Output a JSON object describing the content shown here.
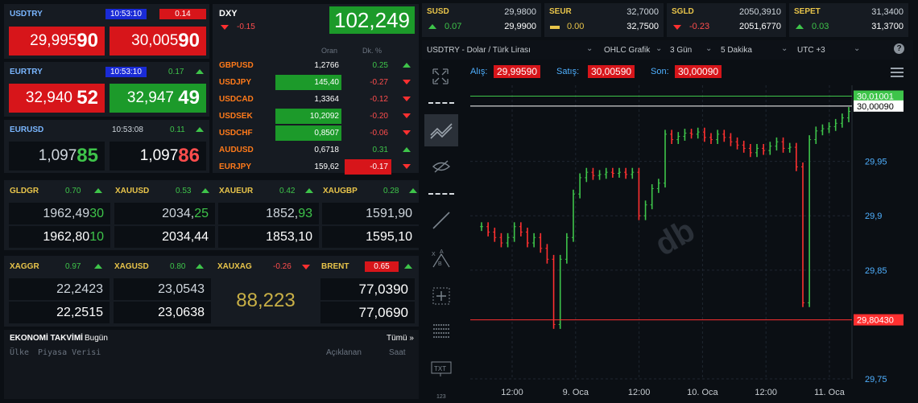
{
  "usdtry": {
    "sym": "USDTRY",
    "time": "10:53:10",
    "chg": "0.14",
    "bid_a": "29,995",
    "bid_b": "90",
    "ask_a": "30,005",
    "ask_b": "90"
  },
  "eurtry": {
    "sym": "EURTRY",
    "time": "10:53:10",
    "chg": "0.17",
    "bid_a": "32,940",
    "bid_b": "52",
    "ask_a": "32,947",
    "ask_b": "49"
  },
  "eurusd": {
    "sym": "EURUSD",
    "time": "10:53:08",
    "chg": "0.11",
    "bid_a": "1,097",
    "bid_b": "85",
    "ask_a": "1,097",
    "ask_b": "86"
  },
  "dxy": {
    "sym": "DXY",
    "chg": "-0.15",
    "value": "102,249"
  },
  "fx_table": {
    "h_rate": "Oran",
    "h_chg": "Dk. %",
    "rows": [
      {
        "sym": "GBPUSD",
        "rate": "1,2766",
        "chg": "0.25",
        "dir": "up",
        "hl": ""
      },
      {
        "sym": "USDJPY",
        "rate": "145,40",
        "chg": "-0.27",
        "dir": "down",
        "hl": "rate"
      },
      {
        "sym": "USDCAD",
        "rate": "1,3364",
        "chg": "-0.12",
        "dir": "down",
        "hl": ""
      },
      {
        "sym": "USDSEK",
        "rate": "10,2092",
        "chg": "-0.20",
        "dir": "down",
        "hl": "rate"
      },
      {
        "sym": "USDCHF",
        "rate": "0,8507",
        "chg": "-0.06",
        "dir": "down",
        "hl": "rate"
      },
      {
        "sym": "AUDUSD",
        "rate": "0,6718",
        "chg": "0.31",
        "dir": "up",
        "hl": ""
      },
      {
        "sym": "EURJPY",
        "rate": "159,62",
        "chg": "-0.17",
        "dir": "down",
        "hl": "chg"
      }
    ]
  },
  "metals": [
    {
      "sym": "GLDGR",
      "chg": "0.70",
      "bid_a": "1962,49",
      "bid_b": "30",
      "ask_a": "1962,80",
      "ask_b": "10",
      "ask_bg": "dark"
    },
    {
      "sym": "XAUUSD",
      "chg": "0.53",
      "bid_a": "2034,",
      "bid_b": "25",
      "ask_a": "2034,44",
      "ask_b": "",
      "ask_bg": "green"
    },
    {
      "sym": "XAUEUR",
      "chg": "0.42",
      "bid_a": "1852,",
      "bid_b": "93",
      "ask_a": "1853,10",
      "ask_b": "",
      "ask_bg": "green"
    },
    {
      "sym": "XAUGBP",
      "chg": "0.28",
      "bid_a": "1591,90",
      "bid_b": "",
      "ask_a": "1595,10",
      "ask_b": "",
      "ask_bg": "dark"
    }
  ],
  "row3": {
    "xaggr": {
      "sym": "XAGGR",
      "chg": "0.97",
      "bid": "22,2423",
      "ask": "22,2515"
    },
    "xagusd": {
      "sym": "XAGUSD",
      "chg": "0.80",
      "bid": "23,0543",
      "ask": "23,0638"
    },
    "xauxag": {
      "sym": "XAUXAG",
      "chg": "-0.26",
      "value": "88,223"
    },
    "brent": {
      "sym": "BRENT",
      "chg": "0.65",
      "bid": "77,0390",
      "ask": "77,0690"
    }
  },
  "calendar": {
    "title": "EKONOMİ TAKVİMİ",
    "subtitle": "Bugün",
    "all": "Tümü »",
    "h_country": "Ülke",
    "h_market": "Piyasa Verisi",
    "h_desc": "Açıklanan",
    "h_time": "Saat"
  },
  "top": [
    {
      "sym": "SUSD",
      "chg": "0.07",
      "v1": "29,9800",
      "v2": "29,9900",
      "dir": "up"
    },
    {
      "sym": "SEUR",
      "chg": "0.00",
      "v1": "32,7000",
      "v2": "32,7500",
      "dir": "flat"
    },
    {
      "sym": "SGLD",
      "chg": "-0.23",
      "v1": "2050,3910",
      "v2": "2051,6770",
      "dir": "down"
    },
    {
      "sym": "SEPET",
      "chg": "0.03",
      "v1": "31,3400",
      "v2": "31,3700",
      "dir": "up"
    }
  ],
  "toolbar": {
    "instrument": "USDTRY - Dolar / Türk Lirası",
    "chart_type": "OHLC Grafik",
    "range": "3 Gün",
    "interval": "5 Dakika",
    "tz": "UTC +3",
    "help": "?"
  },
  "quote": {
    "alis_label": "Alış:",
    "alis": "29,99590",
    "satis_label": "Satış:",
    "satis": "30,00590",
    "son_label": "Son:",
    "son": "30,00090"
  },
  "watermark": "db",
  "colors": {
    "up": "#3ec44a",
    "down": "#ff3030",
    "panel": "#161b22",
    "bg": "#0b0f14",
    "accent": "#7ab6ff"
  },
  "chart_data": {
    "type": "ohlc",
    "title": "USDTRY - Dolar / Türk Lirası",
    "xlabel": "",
    "ylabel": "",
    "ylim": [
      29.75,
      30.02
    ],
    "y_ticks": [
      "29,95",
      "29,9",
      "29,85",
      "29,75"
    ],
    "y_tick_values": [
      29.95,
      29.9,
      29.85,
      29.75
    ],
    "x_ticks": [
      "12:00",
      "9. Oca",
      "12:00",
      "10. Oca",
      "12:00",
      "11. Oca"
    ],
    "price_labels": [
      {
        "text": "30,01001",
        "value": 30.01001,
        "color": "#3ec44a"
      },
      {
        "text": "30,00090",
        "value": 30.0009,
        "color": "#ffffff"
      },
      {
        "text": "29,80430",
        "value": 29.8043,
        "color": "#ff3030"
      }
    ],
    "series": [
      {
        "values": [
          29.89,
          29.885,
          29.88,
          29.875,
          29.88,
          29.89,
          29.885,
          29.875,
          29.88,
          29.87,
          29.86,
          29.8,
          29.86,
          29.88,
          29.92,
          29.935,
          29.94,
          29.937,
          29.938,
          29.94,
          29.939,
          29.94,
          29.938,
          29.94,
          29.9,
          29.91,
          29.925,
          29.93,
          29.975,
          29.97,
          29.973,
          29.976,
          29.975,
          29.977,
          29.972,
          29.97,
          29.975,
          29.972,
          29.968,
          29.965,
          29.962,
          29.958,
          29.962,
          29.96,
          29.964,
          29.968,
          29.962,
          29.963,
          29.945,
          29.82,
          29.97,
          29.978,
          29.98,
          29.982,
          29.985,
          29.99,
          29.996
        ]
      }
    ]
  }
}
